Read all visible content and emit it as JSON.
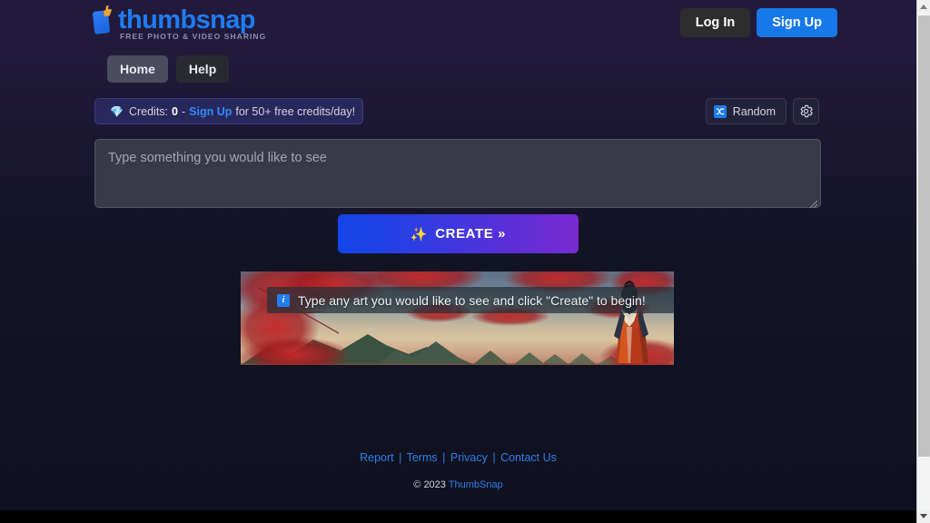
{
  "brand": {
    "name": "thumbsnap",
    "tagline": "FREE PHOTO & VIDEO SHARING",
    "logo_icon": "thumbsnap-logo-icon",
    "accent_blue": "#1f7cf2"
  },
  "header": {
    "login_label": "Log In",
    "signup_label": "Sign Up"
  },
  "nav": {
    "tabs": [
      {
        "label": "Home",
        "active": true
      },
      {
        "label": "Help",
        "active": false
      }
    ]
  },
  "credits": {
    "gem_icon": "gem-icon",
    "label": "Credits:",
    "amount": "0",
    "dash": "-",
    "signup_link": "Sign Up",
    "suffix": "for 50+ free credits/day!"
  },
  "tools": {
    "random_label": "Random",
    "random_icon": "shuffle-icon",
    "settings_icon": "gear-icon"
  },
  "prompt": {
    "value": "",
    "placeholder": "Type something you would like to see"
  },
  "create": {
    "label": "CREATE »",
    "sparkle_icon": "sparkles-icon"
  },
  "banner": {
    "tooltip_icon": "information-icon",
    "tooltip_text": "Type any art you would like to see and click \"Create\" to begin!",
    "artwork_description": "anime landscape with red foliage, green mountains and a figure in a red kimono"
  },
  "footer": {
    "links": [
      "Report",
      "Terms",
      "Privacy",
      "Contact Us"
    ],
    "separator": "|",
    "copyright_prefix": "© 2023",
    "copyright_brand": "ThumbSnap"
  },
  "scrollbar": {
    "up_icon": "scroll-up-arrow-icon",
    "down_icon": "scroll-down-arrow-icon"
  }
}
